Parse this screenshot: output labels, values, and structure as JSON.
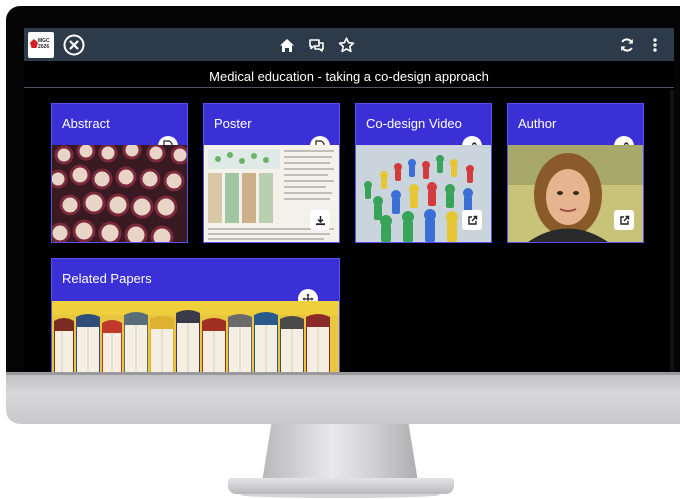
{
  "toolbar": {
    "logo_text": "MGC 2026",
    "close_icon": "close-circle-icon",
    "home_icon": "home-icon",
    "chat_icon": "chat-icon",
    "star_icon": "star-icon",
    "refresh_icon": "refresh-icon",
    "menu_icon": "more-vertical-icon"
  },
  "page": {
    "title": "Medical education - taking a co-design approach"
  },
  "cards": [
    {
      "label": "Abstract",
      "badge": "document-icon"
    },
    {
      "label": "Poster",
      "badge": "document-icon",
      "action": "download-icon"
    },
    {
      "label": "Co-design Video",
      "badge": "link-icon",
      "action": "external-link-icon"
    },
    {
      "label": "Author",
      "badge": "link-icon",
      "action": "external-link-icon"
    },
    {
      "label": "Related Papers",
      "badge": "move-icon"
    }
  ],
  "colors": {
    "card": "#3b2fd6",
    "topbar": "#2d3a4a",
    "screen": "#000000"
  }
}
